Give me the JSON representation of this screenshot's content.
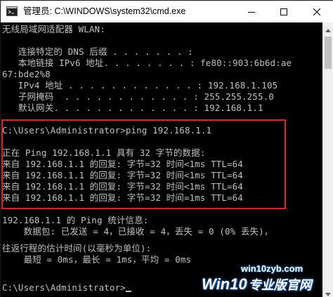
{
  "window": {
    "title": "管理员: C:\\WINDOWS\\system32\\cmd.exe",
    "icon": "cmd-icon",
    "controls": {
      "minimize": "minimize-icon",
      "maximize": "maximize-icon",
      "close": "close-icon"
    }
  },
  "console": {
    "lines": [
      "无线局域网适配器 WLAN:",
      "",
      "   连接特定的 DNS 后缀 . . . . . . . :",
      "   本地链接 IPv6 地址. . . . . . . . : fe80::903:6b6d:ae",
      "67:bde2%8",
      "   IPv4 地址 . . . . . . . . . . . . : 192.168.1.105",
      "   子网掩码  . . . . . . . . . . . . : 255.255.255.0",
      "   默认网关. . . . . . . . . . . . . : 192.168.1.1",
      "",
      "C:\\Users\\Administrator>ping 192.168.1.1",
      "",
      "正在 Ping 192.168.1.1 具有 32 字节的数据:",
      "来自 192.168.1.1 的回复: 字节=32 时间<1ms TTL=64",
      "来自 192.168.1.1 的回复: 字节=32 时间<1ms TTL=64",
      "来自 192.168.1.1 的回复: 字节=32 时间<1ms TTL=64",
      "来自 192.168.1.1 的回复: 字节=32 时间=1ms TTL=64",
      "",
      "192.168.1.1 的 Ping 统计信息:",
      "    数据包: 已发送 = 4，已接收 = 4，丢失 = 0 (0% 丢失)，",
      "往返行程的估计时间(以毫秒为单位):",
      "    最短 = 0ms，最长 = 1ms，平均 = 0ms",
      "",
      "C:\\Users\\Administrator>"
    ]
  },
  "watermark": {
    "url": "win10zyb.com",
    "logo_win": "Win10",
    "logo_cn": "专业版官网"
  },
  "colors": {
    "console_bg": "#000000",
    "console_text": "#c0c0c0",
    "highlight": "#e0202a",
    "watermark_glow": "#1b6fd6"
  }
}
